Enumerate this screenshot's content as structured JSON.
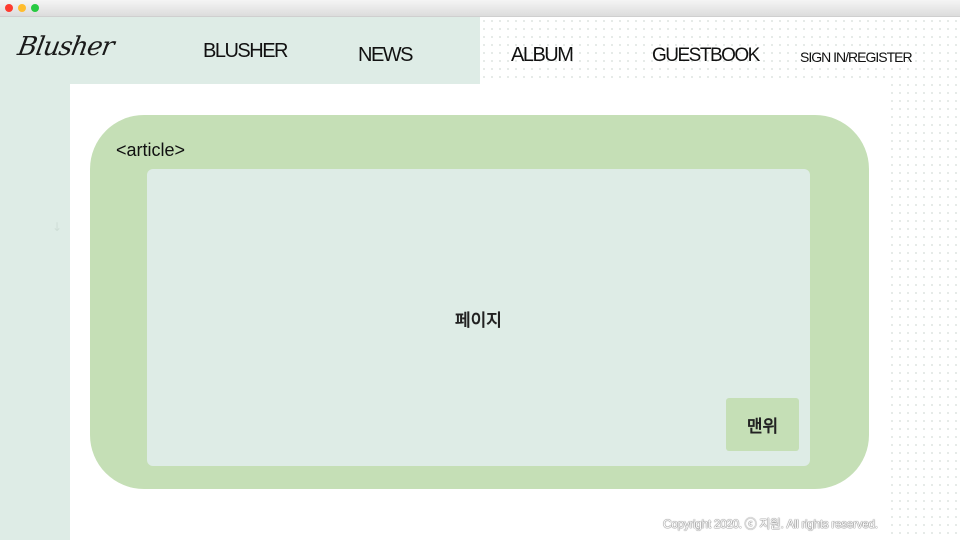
{
  "header": {
    "logo_text": "Blusher",
    "nav": [
      {
        "label": "BLUSHER"
      },
      {
        "label": "NEWS"
      },
      {
        "label": "ALBUM"
      },
      {
        "label": "GUESTBOOK"
      },
      {
        "label": "SIGN IN/REGISTER"
      }
    ]
  },
  "sidebar": {
    "arrow_icon": "↓"
  },
  "main": {
    "article_label": "<article>",
    "page_label": "페이지",
    "top_button_label": "맨위"
  },
  "footer": {
    "copyright": "Copyright 2020. ⓒ 지원. All rights reserved."
  },
  "colors": {
    "mint": "#deece6",
    "green": "#c5dfb6"
  }
}
